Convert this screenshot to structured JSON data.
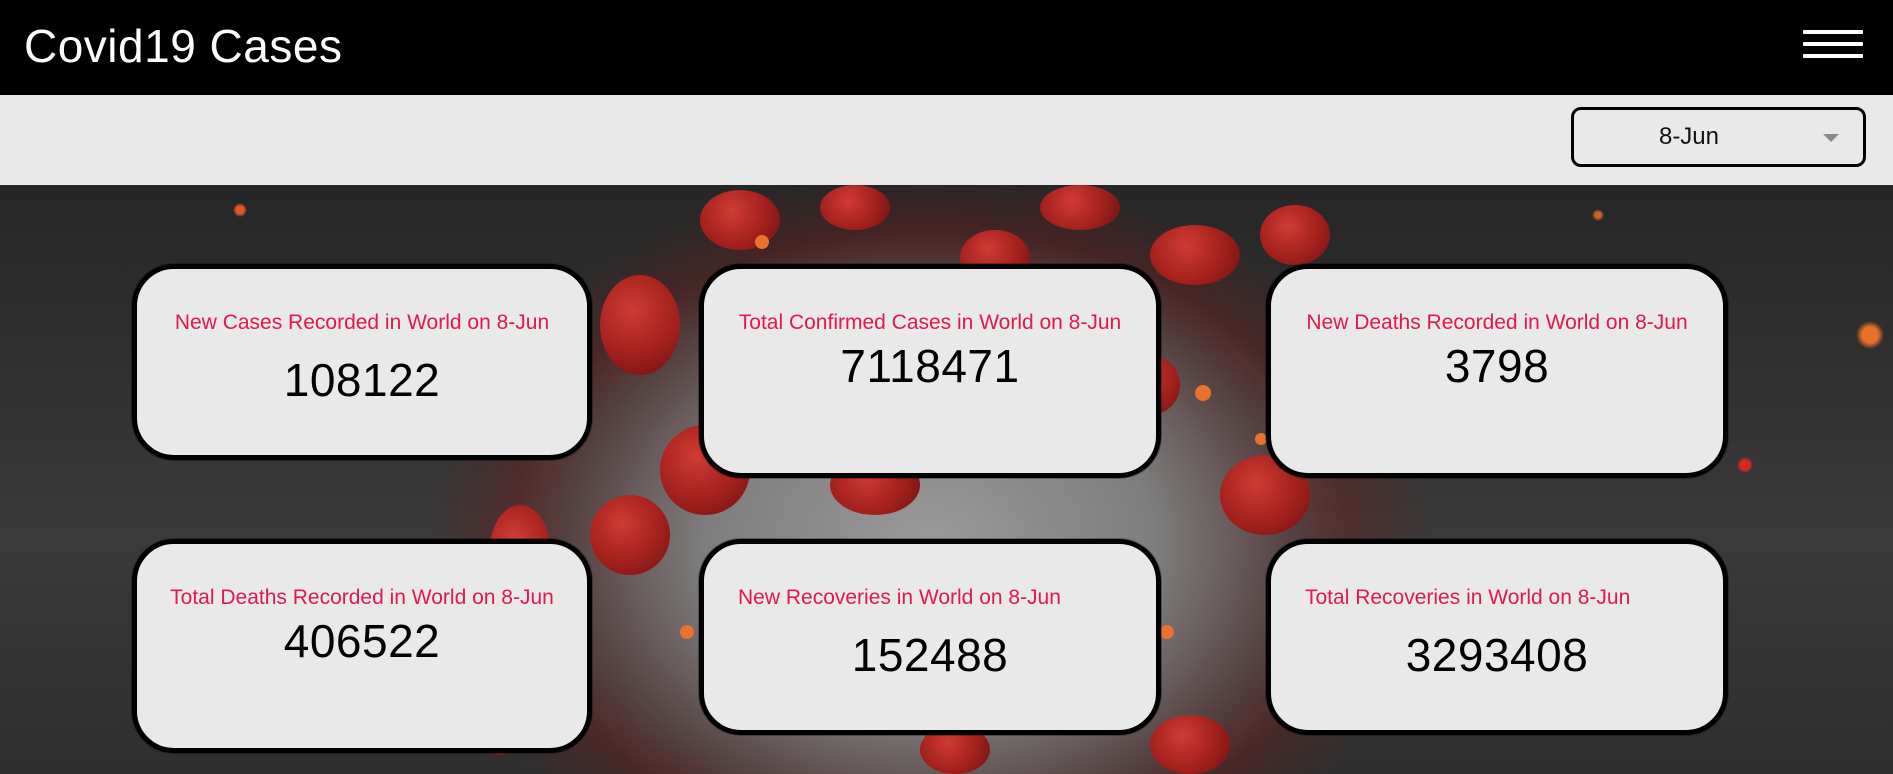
{
  "header": {
    "title": "Covid19 Cases",
    "menu_icon": "hamburger-menu-icon"
  },
  "filter": {
    "selected_date": "8-Jun",
    "caret_icon": "chevron-down-icon"
  },
  "colors": {
    "label": "#e0194e",
    "card_bg": "#e9e9e9",
    "header_bg": "#000000"
  },
  "cards": [
    {
      "label": "New Cases Recorded in World on 8-Jun",
      "value": "108122"
    },
    {
      "label": "Total Confirmed Cases in World on 8-Jun",
      "value": "7118471"
    },
    {
      "label": "New Deaths Recorded in World on 8-Jun",
      "value": "3798"
    },
    {
      "label": "Total Deaths Recorded in World on 8-Jun",
      "value": "406522"
    },
    {
      "label": "New Recoveries in World on 8-Jun",
      "value": "152488"
    },
    {
      "label": "Total Recoveries in World on 8-Jun",
      "value": "3293408"
    }
  ]
}
